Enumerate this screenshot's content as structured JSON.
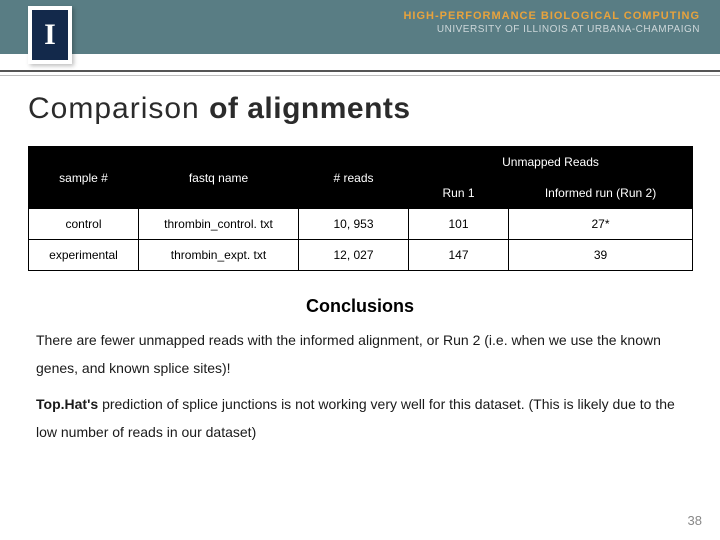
{
  "header": {
    "logo_letter": "I",
    "inst_top": "HIGH-PERFORMANCE BIOLOGICAL COMPUTING",
    "inst_bot": "UNIVERSITY OF ILLINOIS AT URBANA-CHAMPAIGN"
  },
  "title": {
    "part1": "Comparison ",
    "part2": "of alignments"
  },
  "table": {
    "head": {
      "sample": "sample #",
      "fastq": "fastq name",
      "reads": "# reads",
      "unmapped_group": "Unmapped Reads",
      "run1": "Run 1",
      "run2": "Informed run (Run 2)"
    },
    "rows": [
      {
        "sample": "control",
        "fastq": "thrombin_control. txt",
        "reads": "10, 953",
        "run1": "101",
        "run2": "27*"
      },
      {
        "sample": "experimental",
        "fastq": "thrombin_expt. txt",
        "reads": "12, 027",
        "run1": "147",
        "run2": "39"
      }
    ]
  },
  "conclusions": {
    "heading": "Conclusions",
    "p1a": "There are fewer unmapped reads with the informed alignment, or Run 2 (i.e. when we use the known genes, and known splice sites)!",
    "p2_bold": "Top.Hat's",
    "p2_rest": " prediction of splice junctions is not working very well for this dataset. (This is likely due to the low number of reads in our dataset)"
  },
  "page_number": "38"
}
